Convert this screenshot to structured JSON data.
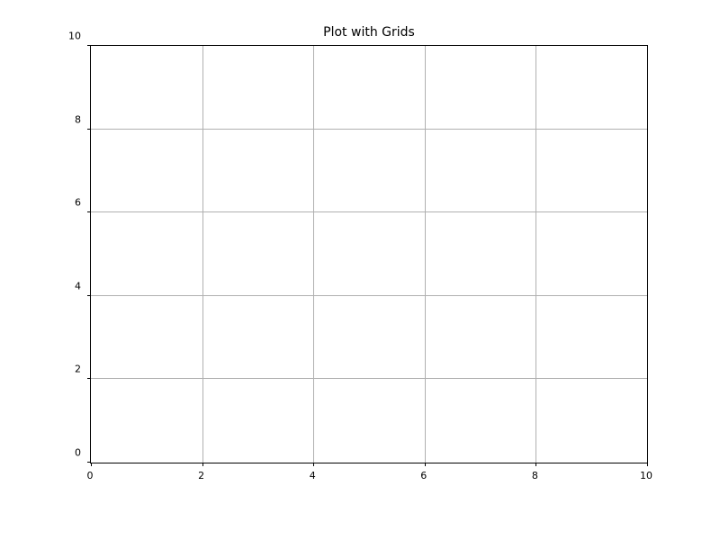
{
  "chart_data": {
    "type": "line",
    "title": "Plot with Grids",
    "xlabel": "",
    "ylabel": "",
    "xlim": [
      0,
      10
    ],
    "ylim": [
      0,
      10
    ],
    "xticks": [
      0,
      2,
      4,
      6,
      8,
      10
    ],
    "yticks": [
      0,
      2,
      4,
      6,
      8,
      10
    ],
    "grid": true,
    "series": []
  }
}
